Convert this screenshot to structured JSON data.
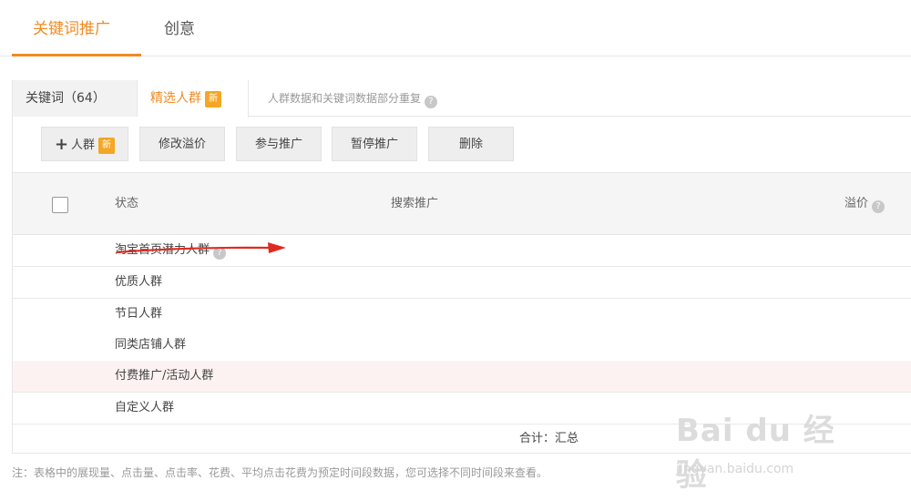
{
  "top_tabs": [
    {
      "label": "关键词推广",
      "active": true
    },
    {
      "label": "创意",
      "active": false
    }
  ],
  "sub_tabs": {
    "first": {
      "label": "关键词（64）"
    },
    "second": {
      "label": "精选人群",
      "badge": "新"
    },
    "note": "人群数据和关键词数据部分重复",
    "note_icon": "info-icon"
  },
  "toolbar": {
    "add_label": "人群",
    "add_badge": "新",
    "modify_bid": "修改溢价",
    "join": "参与推广",
    "pause": "暂停推广",
    "delete": "删除"
  },
  "table": {
    "headers": {
      "status": "状态",
      "search": "搜索推广",
      "premium": "溢价"
    },
    "rows": [
      {
        "label": "淘宝首页潜力人群",
        "has_info": true
      },
      {
        "label": "优质人群"
      },
      {
        "label": "节日人群"
      },
      {
        "label": "同类店铺人群"
      },
      {
        "label": "付费推广/活动人群"
      },
      {
        "label": "自定义人群"
      }
    ],
    "total": "合计：汇总"
  },
  "footnote": "注：表格中的展现量、点击量、点击率、花费、平均点击花费为预定时间段数据，您可选择不同时间段来查看。",
  "watermark": {
    "logo": "Bai du 经验",
    "url": "jingyan.baidu.com"
  },
  "colors": {
    "accent": "#f08b24",
    "badge": "#f5a623",
    "highlight_row": "#fdf2f2",
    "arrow": "#e02a1f"
  }
}
